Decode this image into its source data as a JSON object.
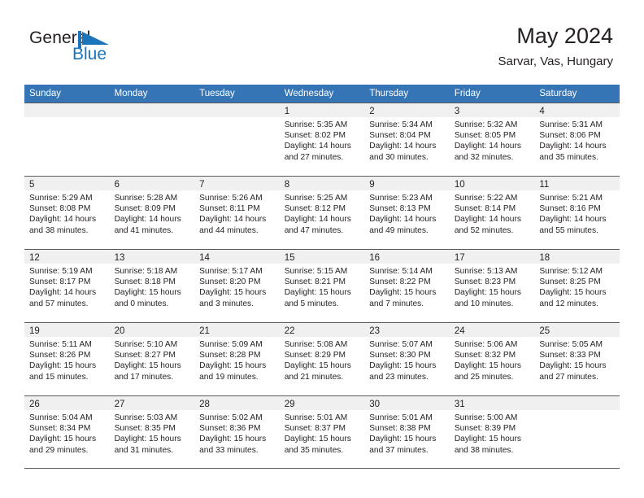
{
  "brand": {
    "name_part1": "General",
    "name_part2": "Blue",
    "flag_icon": "blue-triangle-flag",
    "colors": {
      "text": "#231f20",
      "blue": "#1c74bb"
    }
  },
  "header": {
    "title": "May 2024",
    "subtitle": "Sarvar, Vas, Hungary"
  },
  "calendar": {
    "accent_color": "#3575b5",
    "band_color": "#f0f0f0",
    "weekdays": [
      "Sunday",
      "Monday",
      "Tuesday",
      "Wednesday",
      "Thursday",
      "Friday",
      "Saturday"
    ],
    "weeks": [
      [
        {
          "day": "",
          "sunrise": "",
          "sunset": "",
          "daylight1": "",
          "daylight2": "",
          "empty": true
        },
        {
          "day": "",
          "sunrise": "",
          "sunset": "",
          "daylight1": "",
          "daylight2": "",
          "empty": true
        },
        {
          "day": "",
          "sunrise": "",
          "sunset": "",
          "daylight1": "",
          "daylight2": "",
          "empty": true
        },
        {
          "day": "1",
          "sunrise": "Sunrise: 5:35 AM",
          "sunset": "Sunset: 8:02 PM",
          "daylight1": "Daylight: 14 hours",
          "daylight2": "and 27 minutes."
        },
        {
          "day": "2",
          "sunrise": "Sunrise: 5:34 AM",
          "sunset": "Sunset: 8:04 PM",
          "daylight1": "Daylight: 14 hours",
          "daylight2": "and 30 minutes."
        },
        {
          "day": "3",
          "sunrise": "Sunrise: 5:32 AM",
          "sunset": "Sunset: 8:05 PM",
          "daylight1": "Daylight: 14 hours",
          "daylight2": "and 32 minutes."
        },
        {
          "day": "4",
          "sunrise": "Sunrise: 5:31 AM",
          "sunset": "Sunset: 8:06 PM",
          "daylight1": "Daylight: 14 hours",
          "daylight2": "and 35 minutes."
        }
      ],
      [
        {
          "day": "5",
          "sunrise": "Sunrise: 5:29 AM",
          "sunset": "Sunset: 8:08 PM",
          "daylight1": "Daylight: 14 hours",
          "daylight2": "and 38 minutes."
        },
        {
          "day": "6",
          "sunrise": "Sunrise: 5:28 AM",
          "sunset": "Sunset: 8:09 PM",
          "daylight1": "Daylight: 14 hours",
          "daylight2": "and 41 minutes."
        },
        {
          "day": "7",
          "sunrise": "Sunrise: 5:26 AM",
          "sunset": "Sunset: 8:11 PM",
          "daylight1": "Daylight: 14 hours",
          "daylight2": "and 44 minutes."
        },
        {
          "day": "8",
          "sunrise": "Sunrise: 5:25 AM",
          "sunset": "Sunset: 8:12 PM",
          "daylight1": "Daylight: 14 hours",
          "daylight2": "and 47 minutes."
        },
        {
          "day": "9",
          "sunrise": "Sunrise: 5:23 AM",
          "sunset": "Sunset: 8:13 PM",
          "daylight1": "Daylight: 14 hours",
          "daylight2": "and 49 minutes."
        },
        {
          "day": "10",
          "sunrise": "Sunrise: 5:22 AM",
          "sunset": "Sunset: 8:14 PM",
          "daylight1": "Daylight: 14 hours",
          "daylight2": "and 52 minutes."
        },
        {
          "day": "11",
          "sunrise": "Sunrise: 5:21 AM",
          "sunset": "Sunset: 8:16 PM",
          "daylight1": "Daylight: 14 hours",
          "daylight2": "and 55 minutes."
        }
      ],
      [
        {
          "day": "12",
          "sunrise": "Sunrise: 5:19 AM",
          "sunset": "Sunset: 8:17 PM",
          "daylight1": "Daylight: 14 hours",
          "daylight2": "and 57 minutes."
        },
        {
          "day": "13",
          "sunrise": "Sunrise: 5:18 AM",
          "sunset": "Sunset: 8:18 PM",
          "daylight1": "Daylight: 15 hours",
          "daylight2": "and 0 minutes."
        },
        {
          "day": "14",
          "sunrise": "Sunrise: 5:17 AM",
          "sunset": "Sunset: 8:20 PM",
          "daylight1": "Daylight: 15 hours",
          "daylight2": "and 3 minutes."
        },
        {
          "day": "15",
          "sunrise": "Sunrise: 5:15 AM",
          "sunset": "Sunset: 8:21 PM",
          "daylight1": "Daylight: 15 hours",
          "daylight2": "and 5 minutes."
        },
        {
          "day": "16",
          "sunrise": "Sunrise: 5:14 AM",
          "sunset": "Sunset: 8:22 PM",
          "daylight1": "Daylight: 15 hours",
          "daylight2": "and 7 minutes."
        },
        {
          "day": "17",
          "sunrise": "Sunrise: 5:13 AM",
          "sunset": "Sunset: 8:23 PM",
          "daylight1": "Daylight: 15 hours",
          "daylight2": "and 10 minutes."
        },
        {
          "day": "18",
          "sunrise": "Sunrise: 5:12 AM",
          "sunset": "Sunset: 8:25 PM",
          "daylight1": "Daylight: 15 hours",
          "daylight2": "and 12 minutes."
        }
      ],
      [
        {
          "day": "19",
          "sunrise": "Sunrise: 5:11 AM",
          "sunset": "Sunset: 8:26 PM",
          "daylight1": "Daylight: 15 hours",
          "daylight2": "and 15 minutes."
        },
        {
          "day": "20",
          "sunrise": "Sunrise: 5:10 AM",
          "sunset": "Sunset: 8:27 PM",
          "daylight1": "Daylight: 15 hours",
          "daylight2": "and 17 minutes."
        },
        {
          "day": "21",
          "sunrise": "Sunrise: 5:09 AM",
          "sunset": "Sunset: 8:28 PM",
          "daylight1": "Daylight: 15 hours",
          "daylight2": "and 19 minutes."
        },
        {
          "day": "22",
          "sunrise": "Sunrise: 5:08 AM",
          "sunset": "Sunset: 8:29 PM",
          "daylight1": "Daylight: 15 hours",
          "daylight2": "and 21 minutes."
        },
        {
          "day": "23",
          "sunrise": "Sunrise: 5:07 AM",
          "sunset": "Sunset: 8:30 PM",
          "daylight1": "Daylight: 15 hours",
          "daylight2": "and 23 minutes."
        },
        {
          "day": "24",
          "sunrise": "Sunrise: 5:06 AM",
          "sunset": "Sunset: 8:32 PM",
          "daylight1": "Daylight: 15 hours",
          "daylight2": "and 25 minutes."
        },
        {
          "day": "25",
          "sunrise": "Sunrise: 5:05 AM",
          "sunset": "Sunset: 8:33 PM",
          "daylight1": "Daylight: 15 hours",
          "daylight2": "and 27 minutes."
        }
      ],
      [
        {
          "day": "26",
          "sunrise": "Sunrise: 5:04 AM",
          "sunset": "Sunset: 8:34 PM",
          "daylight1": "Daylight: 15 hours",
          "daylight2": "and 29 minutes."
        },
        {
          "day": "27",
          "sunrise": "Sunrise: 5:03 AM",
          "sunset": "Sunset: 8:35 PM",
          "daylight1": "Daylight: 15 hours",
          "daylight2": "and 31 minutes."
        },
        {
          "day": "28",
          "sunrise": "Sunrise: 5:02 AM",
          "sunset": "Sunset: 8:36 PM",
          "daylight1": "Daylight: 15 hours",
          "daylight2": "and 33 minutes."
        },
        {
          "day": "29",
          "sunrise": "Sunrise: 5:01 AM",
          "sunset": "Sunset: 8:37 PM",
          "daylight1": "Daylight: 15 hours",
          "daylight2": "and 35 minutes."
        },
        {
          "day": "30",
          "sunrise": "Sunrise: 5:01 AM",
          "sunset": "Sunset: 8:38 PM",
          "daylight1": "Daylight: 15 hours",
          "daylight2": "and 37 minutes."
        },
        {
          "day": "31",
          "sunrise": "Sunrise: 5:00 AM",
          "sunset": "Sunset: 8:39 PM",
          "daylight1": "Daylight: 15 hours",
          "daylight2": "and 38 minutes."
        },
        {
          "day": "",
          "sunrise": "",
          "sunset": "",
          "daylight1": "",
          "daylight2": "",
          "empty": true
        }
      ]
    ]
  }
}
